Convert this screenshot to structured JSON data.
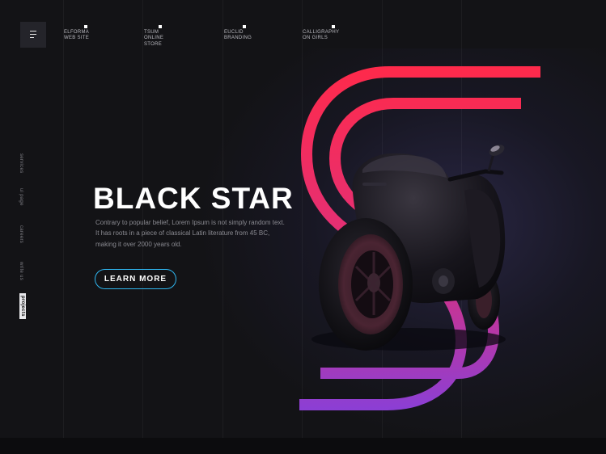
{
  "nav": [
    {
      "label": "ELFORMA\nWEB SITE"
    },
    {
      "label": "TSUM\nONLINE\nSTORE"
    },
    {
      "label": "EUCLID\nBRANDING"
    },
    {
      "label": "CALLIGRAPHY\nON GIRLS"
    }
  ],
  "side_links": [
    {
      "label": "services",
      "active": false
    },
    {
      "label": "ui page",
      "active": false
    },
    {
      "label": "careers",
      "active": false
    },
    {
      "label": "write us",
      "active": false
    },
    {
      "label": "projects",
      "active": true
    }
  ],
  "hero": {
    "title": "BLACK STAR",
    "description": "Contrary to popular belief, Lorem Ipsum is not simply random text. It has roots in a piece of classical Latin literature from 45 BC, making it over 2000 years old.",
    "button_label": "LEARN MORE"
  },
  "colors": {
    "background": "#131316",
    "accent_button": "#2fb6f0",
    "stripe_top": "#ff2a4a",
    "stripe_bottom": "#8a3fd6"
  },
  "icons": [
    "hamburger-menu-icon",
    "nav-marker-icon"
  ]
}
